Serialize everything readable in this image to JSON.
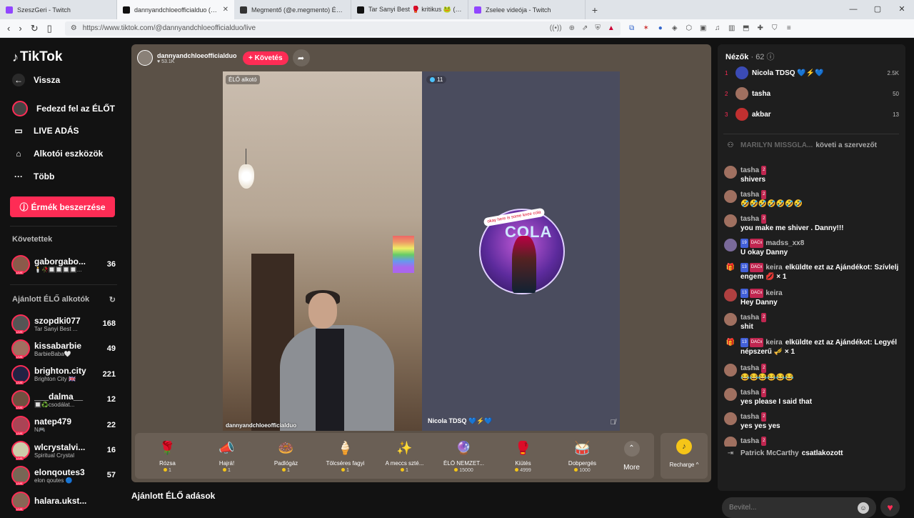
{
  "browser": {
    "tabs": [
      {
        "title": "SzeszGeri - Twitch",
        "color": "#9146ff"
      },
      {
        "title": "dannyandchloeofficialduo (@dan",
        "color": "#111111"
      },
      {
        "title": "Megmentő (@e.megmento) ÉLŐ adá",
        "color": "#333333"
      },
      {
        "title": "Tar Sanyi Best 🥊 kritikus 🐸 (@szop",
        "color": "#111111"
      },
      {
        "title": "Zselee videója - Twitch",
        "color": "#9146ff"
      }
    ],
    "new_tab": "+",
    "url": "https://www.tiktok.com/@dannyandchloeofficialduo/live"
  },
  "sidebar": {
    "logo": "TikTok",
    "back": "Vissza",
    "nav": [
      "Fedezd fel az ÉLŐT",
      "LIVE ADÁS",
      "Alkotói eszközök",
      "Több"
    ],
    "coins_button": "Érmék beszerzése",
    "following_title": "Követettek",
    "following": [
      {
        "name": "gaborgabo...",
        "sub": "🕯️🥀🔲🔲🔲🔲...",
        "count": "36",
        "color": "#8a5a4a"
      }
    ],
    "recommended_title": "Ajánlott ÉLŐ alkotók",
    "recommended": [
      {
        "name": "szopdki077",
        "sub": "Tar Sanyi Best ...",
        "count": "168",
        "color": "#555555"
      },
      {
        "name": "kissabarbie",
        "sub": "BarbieBaba🤍",
        "count": "49",
        "color": "#a07060"
      },
      {
        "name": "brighton.city",
        "sub": "Brighton City 🇬🇧",
        "count": "221",
        "color": "#222244"
      },
      {
        "name": "___dalma__",
        "sub": "🔲♻️csodálat...",
        "count": "12",
        "color": "#705040"
      },
      {
        "name": "natep479",
        "sub": "N🎮",
        "count": "22",
        "color": "#aa4455"
      },
      {
        "name": "wlcrystalvi...",
        "sub": "Spiritual Crystal",
        "count": "16",
        "color": "#ccccaa"
      },
      {
        "name": "elonqoutes3",
        "sub": "elon qoutes 🔵",
        "count": "57",
        "color": "#776655"
      },
      {
        "name": "halara.ukst...",
        "sub": "",
        "count": "",
        "color": "#886655"
      }
    ]
  },
  "stream": {
    "host_name": "dannyandchloeofficialduo",
    "host_likes": "♥ 53.1K",
    "follow_label": "+ Követés",
    "left_tag": "ÉLŐ alkotó",
    "left_name": "dannyandchloeofficialduo",
    "right_viewers": "11",
    "right_name": "Nicola TDSQ 💙⚡💙",
    "badge_text": "COLA",
    "badge_bubble": "okay here is some knee cola"
  },
  "gifts": [
    {
      "name": "Rózsa",
      "price": "1",
      "icon": "🌹"
    },
    {
      "name": "Hajrá!",
      "price": "1",
      "icon": "📣"
    },
    {
      "name": "Padlógáz",
      "price": "1",
      "icon": "🍩"
    },
    {
      "name": "Tölcséres fagyi",
      "price": "1",
      "icon": "🍦"
    },
    {
      "name": "A meccs szté...",
      "price": "1",
      "icon": "✨"
    },
    {
      "name": "ÉLŐ NEMZET...",
      "price": "15000",
      "icon": "🔮"
    },
    {
      "name": "Kiütés",
      "price": "4999",
      "icon": "🥊"
    },
    {
      "name": "Dobpergés",
      "price": "1000",
      "icon": "🥁"
    }
  ],
  "more_label": "More",
  "recharge_label": "Recharge ^",
  "below_title": "Ajánlott ÉLŐ adások",
  "viewers": {
    "title": "Nézők",
    "count": "· 62",
    "list": [
      {
        "rank": "1",
        "name": "Nicola TDSQ 💙⚡💙",
        "score": "2.5K",
        "color": "#3b4bb5"
      },
      {
        "rank": "2",
        "name": "tasha",
        "score": "50",
        "color": "#a07060"
      },
      {
        "rank": "3",
        "name": "akbar",
        "score": "13",
        "color": "#c03030"
      }
    ]
  },
  "chat": [
    {
      "type": "follow",
      "name": "MARILYN MISSGLA...",
      "text": "követi a szervezőt"
    },
    {
      "name": "tasha",
      "level": "2",
      "text": "shivers"
    },
    {
      "name": "tasha",
      "level": "2",
      "text": "🤣🤣🤣🤣🤣🤣🤣"
    },
    {
      "name": "tasha",
      "level": "2",
      "text": "you make me shiver . Danny!!!"
    },
    {
      "name": "madss_xx8",
      "level": "DACx",
      "blue": "19",
      "text": "U okay Danny"
    },
    {
      "type": "gift",
      "name": "keira",
      "level": "DACx",
      "blue": "13",
      "text": "elküldte ezt az Ajándékot: Szívlelj engem 💋 × 1"
    },
    {
      "name": "keira",
      "level": "DACx",
      "blue": "13",
      "text": "Hey Danny"
    },
    {
      "name": "tasha",
      "level": "2",
      "text": "shit"
    },
    {
      "type": "gift",
      "name": "keira",
      "level": "DACx",
      "blue": "13",
      "text": "elküldte ezt az Ajándékot: Legyél népszerű 🎺 × 1"
    },
    {
      "name": "tasha",
      "level": "2",
      "text": "😂😂😂😂😂😂"
    },
    {
      "name": "tasha",
      "level": "2",
      "text": "yes please I said that"
    },
    {
      "name": "tasha",
      "level": "2",
      "text": "yes yes yes"
    },
    {
      "name": "tasha",
      "level": "2",
      "text": ""
    },
    {
      "type": "join",
      "name": "Patrick McCarthy",
      "text": "csatlakozott"
    }
  ],
  "input_placeholder": "Bevitel..."
}
